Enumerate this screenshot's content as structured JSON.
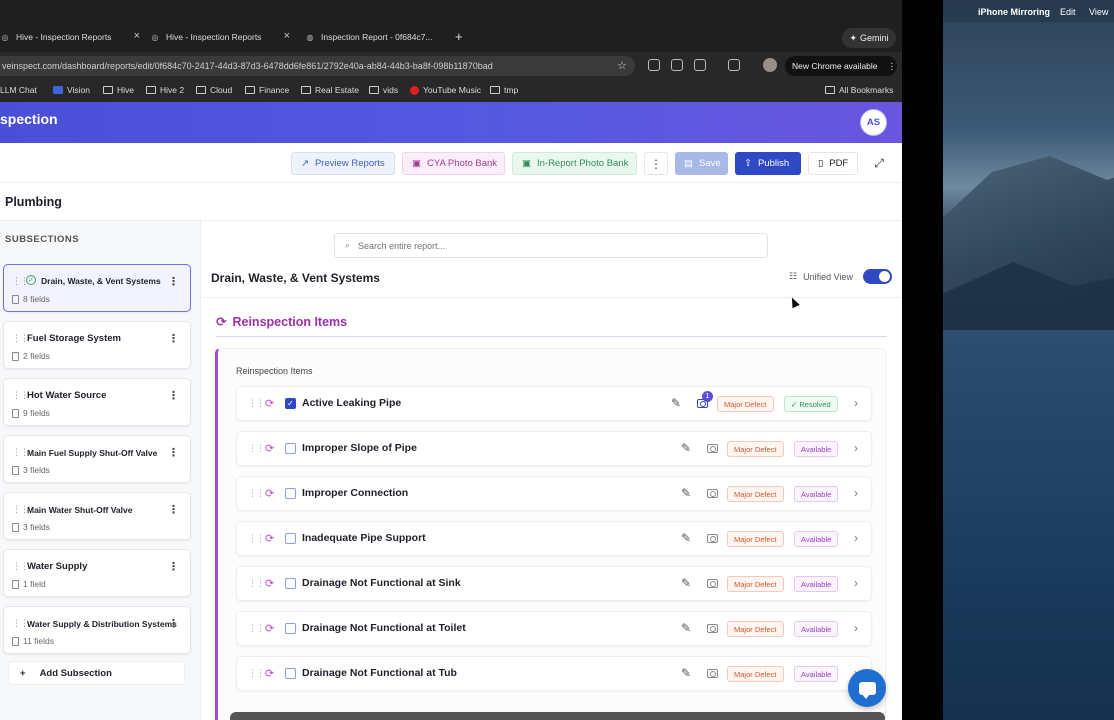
{
  "browser": {
    "tabs": [
      {
        "label": "Hive - Inspection Reports"
      },
      {
        "label": "Hive - Inspection Reports"
      },
      {
        "label": "Inspection Report - 0f684c7..."
      }
    ],
    "gemini_label": "Gemini",
    "url": "veinspect.com/dashboard/reports/edit/0f684c70-2417-44d3-87d3-6478dd6fe861/2792e40a-ab84-44b3-ba8f-098b11870bad",
    "update_label": "New Chrome available",
    "bookmarks": [
      "LLM Chat",
      "Vision",
      "Hive",
      "Hive 2",
      "Cloud",
      "Finance",
      "Real Estate",
      "vids",
      "YouTube Music",
      "tmp"
    ],
    "all_bookmarks": "All Bookmarks"
  },
  "app": {
    "title": "spection",
    "avatar_initials": "AS"
  },
  "actions": {
    "preview": "Preview Reports",
    "cya": "CYA Photo Bank",
    "inreport": "In-Report Photo Bank",
    "more": "⋮",
    "save": "Save",
    "publish": "Publish",
    "pdf": "PDF"
  },
  "section": {
    "title": "Plumbing"
  },
  "sidebar": {
    "label": "SUBSECTIONS",
    "items": [
      {
        "name": "Drain, Waste, & Vent Systems",
        "fields": "8 fields"
      },
      {
        "name": "Fuel Storage System",
        "fields": "2 fields"
      },
      {
        "name": "Hot Water Source",
        "fields": "9 fields"
      },
      {
        "name": "Main Fuel Supply Shut-Off Valve",
        "fields": "3 fields"
      },
      {
        "name": "Main Water Shut-Off Valve",
        "fields": "3 fields"
      },
      {
        "name": "Water Supply",
        "fields": "1 field"
      },
      {
        "name": "Water Supply & Distribution Systems",
        "fields": "11 fields"
      }
    ],
    "add_label": "Add Subsection"
  },
  "main": {
    "search_placeholder": "Search entire report...",
    "subsection_title": "Drain, Waste, & Vent Systems",
    "unified_view_label": "Unified View",
    "reinspection_heading": "Reinspection Items",
    "card_label": "Reinspection Items",
    "items": [
      {
        "name": "Active Leaking Pipe",
        "checked": true,
        "photo_count": "1",
        "defect": "Major Defect",
        "status": "✓ Resolved"
      },
      {
        "name": "Improper Slope of Pipe",
        "checked": false,
        "defect": "Major Defect",
        "status": "Available"
      },
      {
        "name": "Improper Connection",
        "checked": false,
        "defect": "Major Defect",
        "status": "Available"
      },
      {
        "name": "Inadequate Pipe Support",
        "checked": false,
        "defect": "Major Defect",
        "status": "Available"
      },
      {
        "name": "Drainage Not Functional at Sink",
        "checked": false,
        "defect": "Major Defect",
        "status": "Available"
      },
      {
        "name": "Drainage Not Functional at Toilet",
        "checked": false,
        "defect": "Major Defect",
        "status": "Available"
      },
      {
        "name": "Drainage Not Functional at Tub",
        "checked": false,
        "defect": "Major Defect",
        "status": "Available"
      }
    ]
  },
  "desktop": {
    "menubar": [
      "iPhone Mirroring",
      "Edit",
      "View"
    ]
  }
}
